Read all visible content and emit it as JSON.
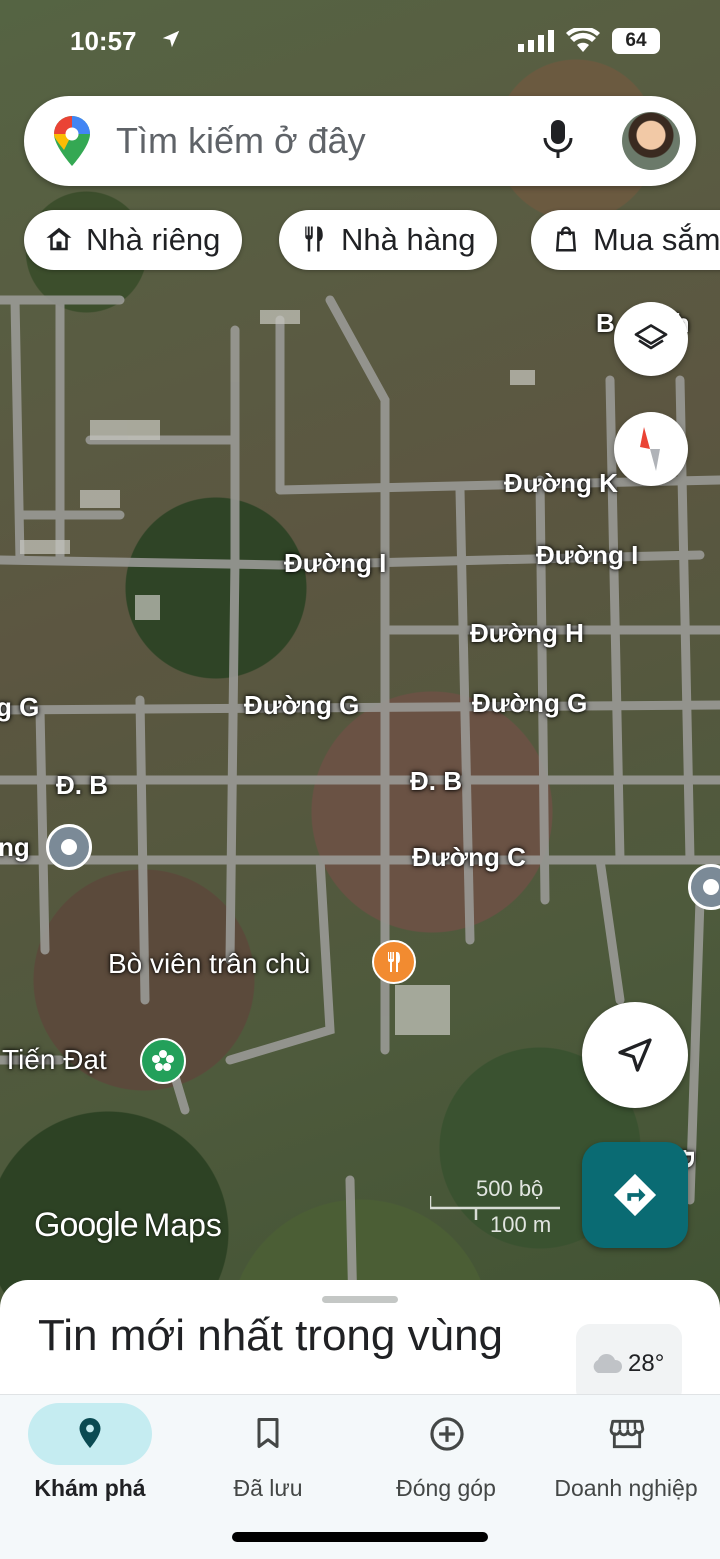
{
  "status_bar": {
    "time": "10:57",
    "battery": "64"
  },
  "search": {
    "placeholder": "Tìm kiếm ở đây"
  },
  "chips": [
    {
      "label": "Nhà riêng",
      "icon": "home-icon"
    },
    {
      "label": "Nhà hàng",
      "icon": "restaurant-icon"
    },
    {
      "label": "Mua sắm",
      "icon": "shopping-bag-icon"
    }
  ],
  "map": {
    "road_labels": [
      "Đường K",
      "Đường I",
      "Đường I",
      "Đường H",
      "g G",
      "Đường G",
      "Đường G",
      "Đ. B",
      "Đ. B",
      "Đường C",
      "ng",
      "B",
      "Đ"
    ],
    "places": [
      {
        "name": "Bò viên trân chù",
        "type": "restaurant"
      },
      {
        "name": "Tiến Đạt",
        "type": "flower-shop"
      }
    ],
    "scale_imperial": "500 bộ",
    "scale_metric": "100 m",
    "logo_google": "Google",
    "logo_maps": "Maps",
    "partial_label_right": "Bách"
  },
  "sheet": {
    "title": "Tin mới nhất trong vùng",
    "temperature": "28°"
  },
  "nav": [
    {
      "label": "Khám phá",
      "icon": "explore-pin-icon",
      "active": true
    },
    {
      "label": "Đã lưu",
      "icon": "bookmark-icon",
      "active": false
    },
    {
      "label": "Đóng góp",
      "icon": "add-circle-icon",
      "active": false
    },
    {
      "label": "Doanh nghiệp",
      "icon": "storefront-icon",
      "active": false
    }
  ],
  "colors": {
    "accent_teal": "#0a6b73",
    "nav_active_pill": "#c5ecf1",
    "restaurant_orange": "#f28b30",
    "flower_green": "#23a05a"
  }
}
